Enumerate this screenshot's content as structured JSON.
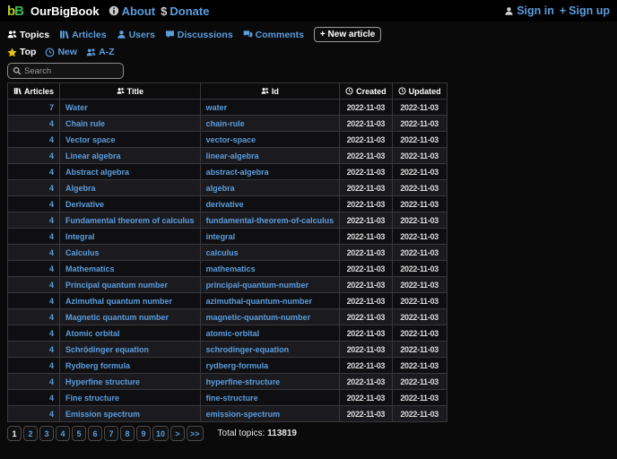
{
  "topbar": {
    "logo": {
      "part1": "b",
      "part2": "B"
    },
    "brand": "OurBigBook",
    "about_label": "About",
    "donate_symbol": "$",
    "donate_label": "Donate",
    "signin_label": "Sign in",
    "signup_symbol": "+",
    "signup_label": "Sign up"
  },
  "nav": {
    "tabs": [
      {
        "label": "Topics",
        "icon": "people-icon",
        "active": true
      },
      {
        "label": "Articles",
        "icon": "books-icon",
        "active": false
      },
      {
        "label": "Users",
        "icon": "person-icon",
        "active": false
      },
      {
        "label": "Discussions",
        "icon": "speech-bubble-icon",
        "active": false
      },
      {
        "label": "Comments",
        "icon": "speech-bubbles-icon",
        "active": false
      }
    ],
    "new_article_label": "+ New article"
  },
  "sort": {
    "items": [
      {
        "label": "Top",
        "icon": "star-icon",
        "active": true
      },
      {
        "label": "New",
        "icon": "clock-icon",
        "active": false
      },
      {
        "label": "A-Z",
        "icon": "people-icon",
        "active": false
      }
    ]
  },
  "search": {
    "placeholder": "Search"
  },
  "table": {
    "headers": [
      {
        "label": "Articles",
        "icon": "books-icon"
      },
      {
        "label": "Title",
        "icon": "people-icon"
      },
      {
        "label": "Id",
        "icon": "people-icon"
      },
      {
        "label": "Created",
        "icon": "clock-icon"
      },
      {
        "label": "Updated",
        "icon": "clock-icon"
      }
    ],
    "rows": [
      {
        "articles": "7",
        "title": "Water",
        "id": "water",
        "created": "2022-11-03",
        "updated": "2022-11-03"
      },
      {
        "articles": "4",
        "title": "Chain rule",
        "id": "chain-rule",
        "created": "2022-11-03",
        "updated": "2022-11-03"
      },
      {
        "articles": "4",
        "title": "Vector space",
        "id": "vector-space",
        "created": "2022-11-03",
        "updated": "2022-11-03"
      },
      {
        "articles": "4",
        "title": "Linear algebra",
        "id": "linear-algebra",
        "created": "2022-11-03",
        "updated": "2022-11-03"
      },
      {
        "articles": "4",
        "title": "Abstract algebra",
        "id": "abstract-algebra",
        "created": "2022-11-03",
        "updated": "2022-11-03"
      },
      {
        "articles": "4",
        "title": "Algebra",
        "id": "algebra",
        "created": "2022-11-03",
        "updated": "2022-11-03"
      },
      {
        "articles": "4",
        "title": "Derivative",
        "id": "derivative",
        "created": "2022-11-03",
        "updated": "2022-11-03"
      },
      {
        "articles": "4",
        "title": "Fundamental theorem of calculus",
        "id": "fundamental-theorem-of-calculus",
        "created": "2022-11-03",
        "updated": "2022-11-03"
      },
      {
        "articles": "4",
        "title": "Integral",
        "id": "integral",
        "created": "2022-11-03",
        "updated": "2022-11-03"
      },
      {
        "articles": "4",
        "title": "Calculus",
        "id": "calculus",
        "created": "2022-11-03",
        "updated": "2022-11-03"
      },
      {
        "articles": "4",
        "title": "Mathematics",
        "id": "mathematics",
        "created": "2022-11-03",
        "updated": "2022-11-03"
      },
      {
        "articles": "4",
        "title": "Principal quantum number",
        "id": "principal-quantum-number",
        "created": "2022-11-03",
        "updated": "2022-11-03"
      },
      {
        "articles": "4",
        "title": "Azimuthal quantum number",
        "id": "azimuthal-quantum-number",
        "created": "2022-11-03",
        "updated": "2022-11-03"
      },
      {
        "articles": "4",
        "title": "Magnetic quantum number",
        "id": "magnetic-quantum-number",
        "created": "2022-11-03",
        "updated": "2022-11-03"
      },
      {
        "articles": "4",
        "title": "Atomic orbital",
        "id": "atomic-orbital",
        "created": "2022-11-03",
        "updated": "2022-11-03"
      },
      {
        "articles": "4",
        "title": "Schrödinger equation",
        "id": "schrodinger-equation",
        "created": "2022-11-03",
        "updated": "2022-11-03"
      },
      {
        "articles": "4",
        "title": "Rydberg formula",
        "id": "rydberg-formula",
        "created": "2022-11-03",
        "updated": "2022-11-03"
      },
      {
        "articles": "4",
        "title": "Hyperfine structure",
        "id": "hyperfine-structure",
        "created": "2022-11-03",
        "updated": "2022-11-03"
      },
      {
        "articles": "4",
        "title": "Fine structure",
        "id": "fine-structure",
        "created": "2022-11-03",
        "updated": "2022-11-03"
      },
      {
        "articles": "4",
        "title": "Emission spectrum",
        "id": "emission-spectrum",
        "created": "2022-11-03",
        "updated": "2022-11-03"
      }
    ]
  },
  "pagination": {
    "pages": [
      "1",
      "2",
      "3",
      "4",
      "5",
      "6",
      "7",
      "8",
      "9",
      "10",
      ">",
      ">>"
    ],
    "current": "1",
    "total_label": "Total topics: ",
    "total_value": "113819"
  },
  "colors": {
    "link": "#5b9ddd",
    "star": "#e8c20f",
    "logo_yellow": "#b9cc1e",
    "logo_green": "#3fb94f"
  }
}
